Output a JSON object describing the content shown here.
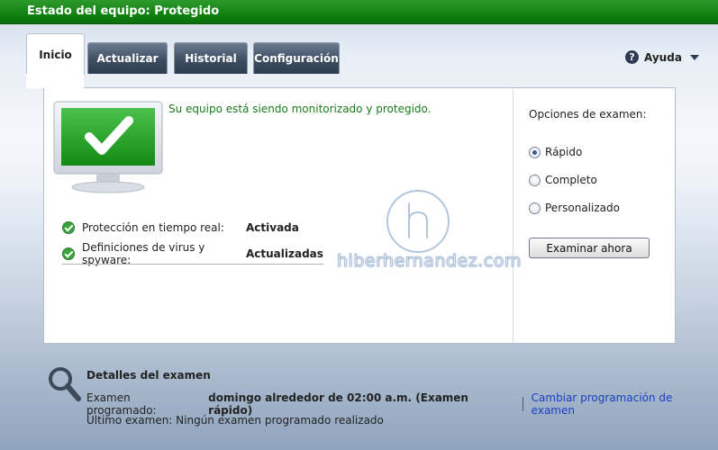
{
  "window": {
    "title": "Estado del equipo: Protegido"
  },
  "tabs": [
    {
      "label": "Inicio",
      "active": true
    },
    {
      "label": "Actualizar",
      "active": false
    },
    {
      "label": "Historial",
      "active": false
    },
    {
      "label": "Configuración",
      "active": false
    }
  ],
  "help": {
    "label": "Ayuda",
    "icon": "question-circle-icon"
  },
  "status": {
    "message": "Su equipo está siendo monitorizado y protegido.",
    "icon": "protected-monitor-icon",
    "rows": [
      {
        "label": "Protección en tiempo real:",
        "value": "Activada",
        "icon": "green-check-icon"
      },
      {
        "label": "Definiciones de virus y spyware:",
        "value": "Actualizadas",
        "icon": "green-check-icon"
      }
    ]
  },
  "scan_options": {
    "heading": "Opciones de examen:",
    "options": [
      {
        "label": "Rápido",
        "checked": true
      },
      {
        "label": "Completo",
        "checked": false
      },
      {
        "label": "Personalizado",
        "checked": false
      }
    ],
    "button_label": "Examinar ahora"
  },
  "scan_details": {
    "title": "Detalles del examen",
    "scheduled_label": "Examen programado:",
    "scheduled_value": "domingo alrededor de 02:00 a.m. (Examen rápido)",
    "change_link": "Cambiar programación de examen",
    "last_scan": "Último examen: Ningún examen programado realizado"
  },
  "watermark": {
    "text": "hiberhernandez.com"
  },
  "colors": {
    "titlebar": "#118211",
    "status_text": "#1b7a1b",
    "link": "#1a3ec4",
    "tab_inactive": "#3e4d61"
  }
}
